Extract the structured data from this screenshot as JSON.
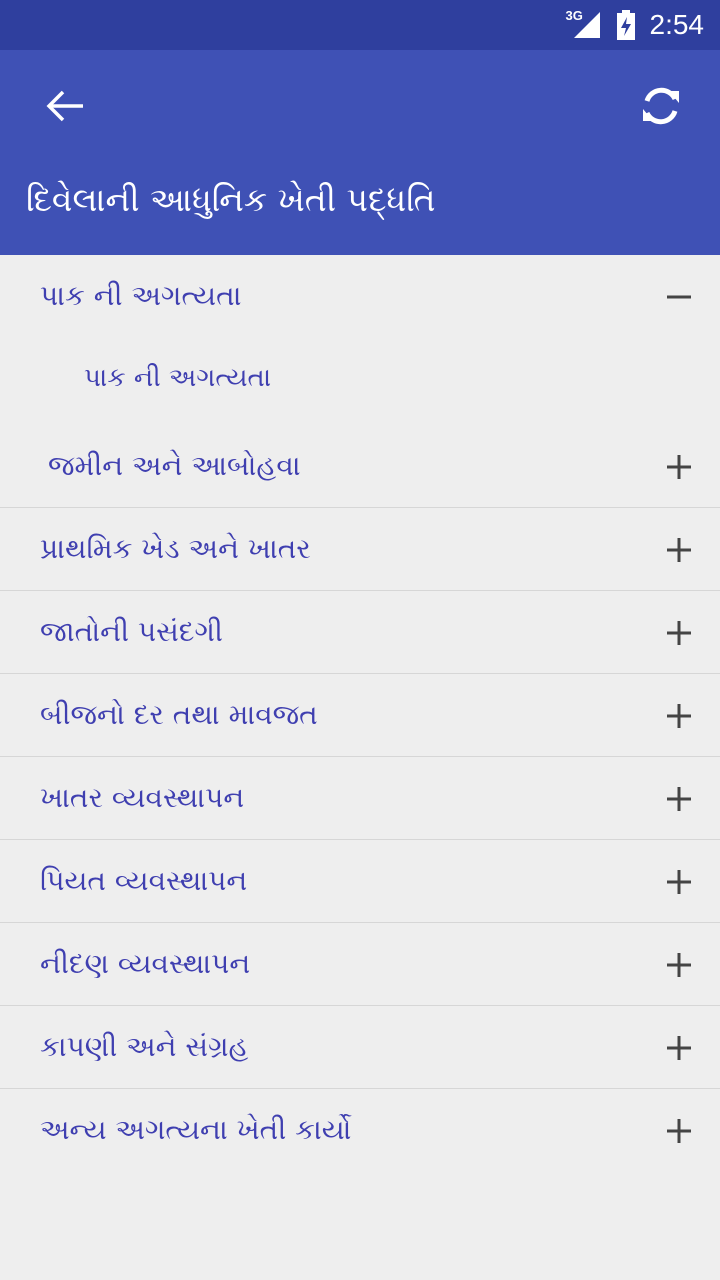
{
  "status_bar": {
    "network": "3G",
    "time": "2:54"
  },
  "app_bar": {
    "title": "દિવેલાની આધુનિક ખેતી પદ્ધતિ",
    "back_icon": "arrow-left-icon",
    "refresh_icon": "refresh-icon"
  },
  "colors": {
    "primary": "#3f51b5",
    "primary_dark": "#2f3f9e",
    "text": "#3f3fb0",
    "background": "#eeeeee"
  },
  "list": {
    "expanded": {
      "label": "પાક ની અગત્યતા",
      "toggle": "−",
      "child": "પાક ની અગત્યતા",
      "sub_label": "જમીન અને આબોહવા",
      "sub_toggle": "+"
    },
    "items": [
      {
        "label": "પ્રાથમિક ખેડ અને ખાતર",
        "toggle": "+"
      },
      {
        "label": "જાતોની પસંદગી",
        "toggle": "+"
      },
      {
        "label": "બીજનો દર તથા માવજત",
        "toggle": "+"
      },
      {
        "label": "ખાતર વ્યવસ્થાપન",
        "toggle": "+"
      },
      {
        "label": "પિયત વ્યવસ્થાપન",
        "toggle": "+"
      },
      {
        "label": "નીદણ વ્યવસ્થાપન",
        "toggle": "+"
      },
      {
        "label": "કાપણી અને સંગ્રહ",
        "toggle": "+"
      },
      {
        "label": "અન્ય અગત્યના ખેતી કાર્યો",
        "toggle": "+"
      }
    ]
  }
}
